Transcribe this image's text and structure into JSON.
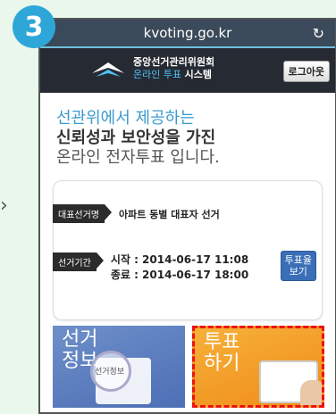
{
  "step_number": "3",
  "browser": {
    "url": "kvoting.go.kr"
  },
  "header": {
    "org_name": "중앙선거관리위원회",
    "system_name_prefix": "온라인 투표",
    "system_name_suffix": "시스템",
    "logout_label": "로그아웃"
  },
  "hero": {
    "line1": "선관위에서 제공하는",
    "line2": "신뢰성과 보안성을 가진",
    "line3": "온라인 전자투표 입니다."
  },
  "election": {
    "name_tag": "대표선거명",
    "name": "아파트 동별 대표자 선거",
    "period_tag": "선거기간",
    "start": "시작 : 2014-06-17 11:08",
    "end": "종료 : 2014-06-17 18:00",
    "turnout_button_line1": "투표율",
    "turnout_button_line2": "보기"
  },
  "tiles": {
    "info_line1": "선거",
    "info_line2": "정보",
    "info_image_label": "선거정보",
    "vote_line1": "투표",
    "vote_line2": "하기"
  },
  "colors": {
    "badge": "#2ea7d8",
    "highlight": "#e11111"
  }
}
